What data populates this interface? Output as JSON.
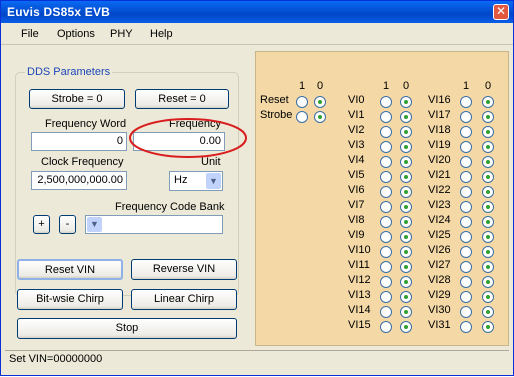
{
  "window": {
    "title": "Euvis DS85x EVB"
  },
  "menu": [
    "File",
    "Options",
    "PHY",
    "Help"
  ],
  "dds": {
    "group_title": "DDS Parameters",
    "strobe_button": "Strobe = 0",
    "reset_button": "Reset = 0",
    "freq_word_label": "Frequency Word",
    "freq_word_value": "0",
    "freq_label": "Frequency",
    "freq_value": "0.00",
    "clock_label": "Clock Frequency",
    "clock_value": "2,500,000,000.00",
    "unit_label": "Unit",
    "unit_value": "Hz",
    "code_bank_label": "Frequency Code Bank",
    "plus": "+",
    "minus": "-"
  },
  "actions": {
    "reset_vin": "Reset VIN",
    "reverse_vin": "Reverse VIN",
    "bitwise_chirp": "Bit-wsie Chirp",
    "linear_chirp": "Linear Chirp",
    "stop": "Stop"
  },
  "radio_panel": {
    "col_headers": [
      "1",
      "0"
    ],
    "control_rows": [
      "Reset",
      "Strobe"
    ],
    "vi_rows": [
      "VI0",
      "VI1",
      "VI2",
      "VI3",
      "VI4",
      "VI5",
      "VI6",
      "VI7",
      "VI8",
      "VI9",
      "VI10",
      "VI11",
      "VI12",
      "VI13",
      "VI14",
      "VI15",
      "VI16",
      "VI17",
      "VI18",
      "VI19",
      "VI20",
      "VI21",
      "VI22",
      "VI23",
      "VI24",
      "VI25",
      "VI26",
      "VI27",
      "VI28",
      "VI29",
      "VI30",
      "VI31"
    ]
  },
  "status": {
    "text": "Set VIN=00000000"
  },
  "colors": {
    "title_bar": "#0453d6",
    "panel": "#f4d9a7",
    "annotation": "#d81e1e"
  }
}
